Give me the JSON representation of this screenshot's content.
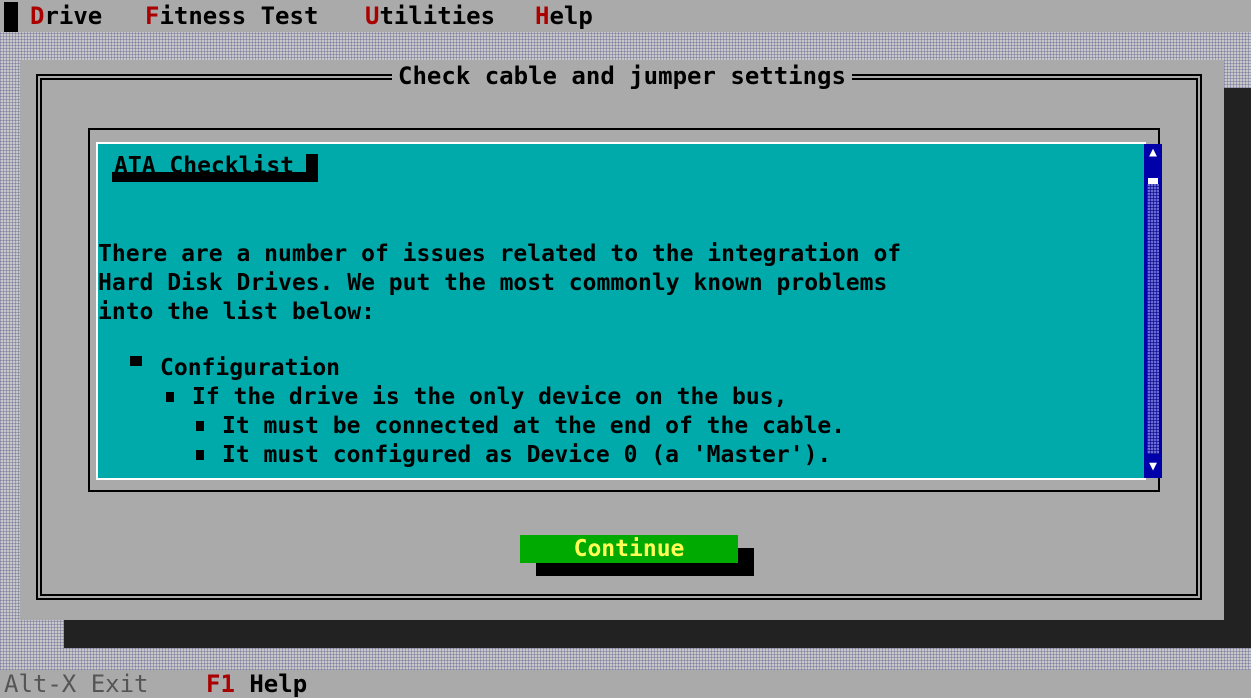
{
  "menubar": {
    "items": [
      {
        "hotkey": "D",
        "rest": "rive"
      },
      {
        "hotkey": "F",
        "rest": "itness Test"
      },
      {
        "hotkey": "U",
        "rest": "tilities"
      },
      {
        "hotkey": "H",
        "rest": "elp"
      }
    ]
  },
  "dialog": {
    "title": "Check cable and jumper settings",
    "heading": "ATA Checklist",
    "paragraph": [
      "There are a number of issues related to the integration of",
      "Hard Disk Drives. We put the most commonly known problems",
      "into the list below:"
    ],
    "list": {
      "level1": "Configuration",
      "level2": "If the drive is the only device on the bus,",
      "level3": [
        "It must be connected at the end of the cable.",
        "It must configured as Device 0 (a 'Master')."
      ]
    },
    "continue_label": "Continue"
  },
  "statusbar": {
    "exit_key": "Alt-X",
    "exit_label": "Exit",
    "help_key": "F1",
    "help_label": "Help"
  },
  "colors": {
    "desktop": "#c8c8c8",
    "dialog": "#aaaaaa",
    "viewer": "#00aaaa",
    "scrollbar": "#0000aa",
    "button": "#00aa00",
    "button_text": "#ffff55",
    "hotkey": "#aa0000"
  }
}
